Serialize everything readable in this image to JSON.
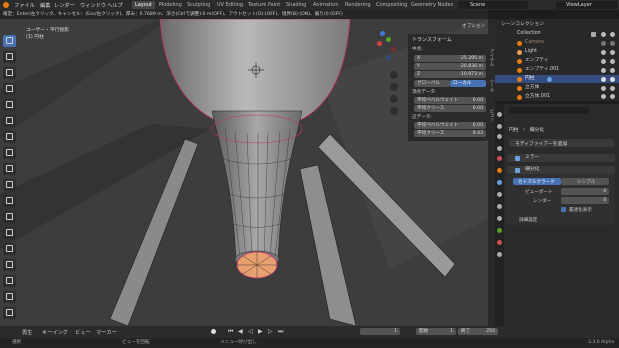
{
  "topbar": {
    "menus": [
      "ファイル",
      "編集",
      "レンダー",
      "ウィンドウ",
      "ヘルプ"
    ],
    "workspaces": [
      "Layout",
      "Modeling",
      "Sculpting",
      "UV Editing",
      "Texture Paint",
      "Shading",
      "Animation",
      "Rendering",
      "Compositing",
      "Geometry Nodes"
    ],
    "active_workspace": "Layout",
    "scene_label": "Scene",
    "view_layer_label": "ViewLayer"
  },
  "status_line": "確定：Enter/左クリック、キャンセル：(Esc/右クリック)、厚み：0.7689 m、深さ(Ctrlで調整):0 m(OFF)、アウトセット(O):(OFF)、境界(B):(ON)、偏り(I):(OFF)",
  "viewport": {
    "view_name": "ユーザー・平行投影",
    "object_name": "(1) 円柱",
    "options_label": "オプション"
  },
  "transform_panel": {
    "title": "トランスフォーム",
    "median_label": "中点:",
    "x_label": "X",
    "x_value": "-25.395 m",
    "y_label": "Y",
    "y_value": "-20.836 m",
    "z_label": "Z",
    "z_value": "-10.973 m",
    "global_label": "グローバル",
    "local_label": "ローカル",
    "vertex_data_label": "頂点データ:",
    "vertex_bevel_label": "平均ベベルウェイト",
    "vertex_bevel_value": "0.00",
    "vertex_crease_label": "平均クリース",
    "vertex_crease_value": "0.00",
    "edge_data_label": "辺データ:",
    "edge_bevel_label": "平均ベベルウェイト",
    "edge_bevel_value": "0.00",
    "edge_crease_label": "平均クリース",
    "edge_crease_value": "0.43"
  },
  "n_tabs": [
    "アイテム",
    "ツール",
    "ビュー"
  ],
  "outliner": {
    "title": "シーンコレクション",
    "rows": [
      {
        "name": "Collection"
      },
      {
        "name": "Camera"
      },
      {
        "name": "Light"
      },
      {
        "name": "エンプティ"
      },
      {
        "name": "エンプティ.001"
      },
      {
        "name": "円柱"
      },
      {
        "name": "立方体"
      },
      {
        "name": "立方体.001"
      }
    ]
  },
  "properties": {
    "object_name": "円柱",
    "modifier_name": "細分化",
    "add_modifier_label": "モディファイアーを追加",
    "mirror_label": "ミラー",
    "subdiv_label": "細分化",
    "catmull_label": "カトマルクラーク",
    "simple_label": "シンプル",
    "viewport_label": "ビューポート",
    "viewport_value": "4",
    "render_label": "レンダー",
    "render_value": "4",
    "optimal_label": "最適化表示",
    "advanced_label": "詳細設定"
  },
  "timeline": {
    "menus": [
      "再生",
      "キーイング",
      "ビュー",
      "マーカー"
    ],
    "current_frame": "1",
    "start_label": "開始",
    "start_value": "1",
    "end_label": "終了",
    "end_value": "250"
  },
  "bottombar": {
    "left_text": "選択",
    "middle_text": "ビューを回転",
    "menu_text": "メニュー呼び出し",
    "version": "3.3.0 Alpha"
  },
  "colors": {
    "accent": "#4772b3",
    "selected_face": "#e8a070",
    "edge_highlight": "#c0306a"
  }
}
